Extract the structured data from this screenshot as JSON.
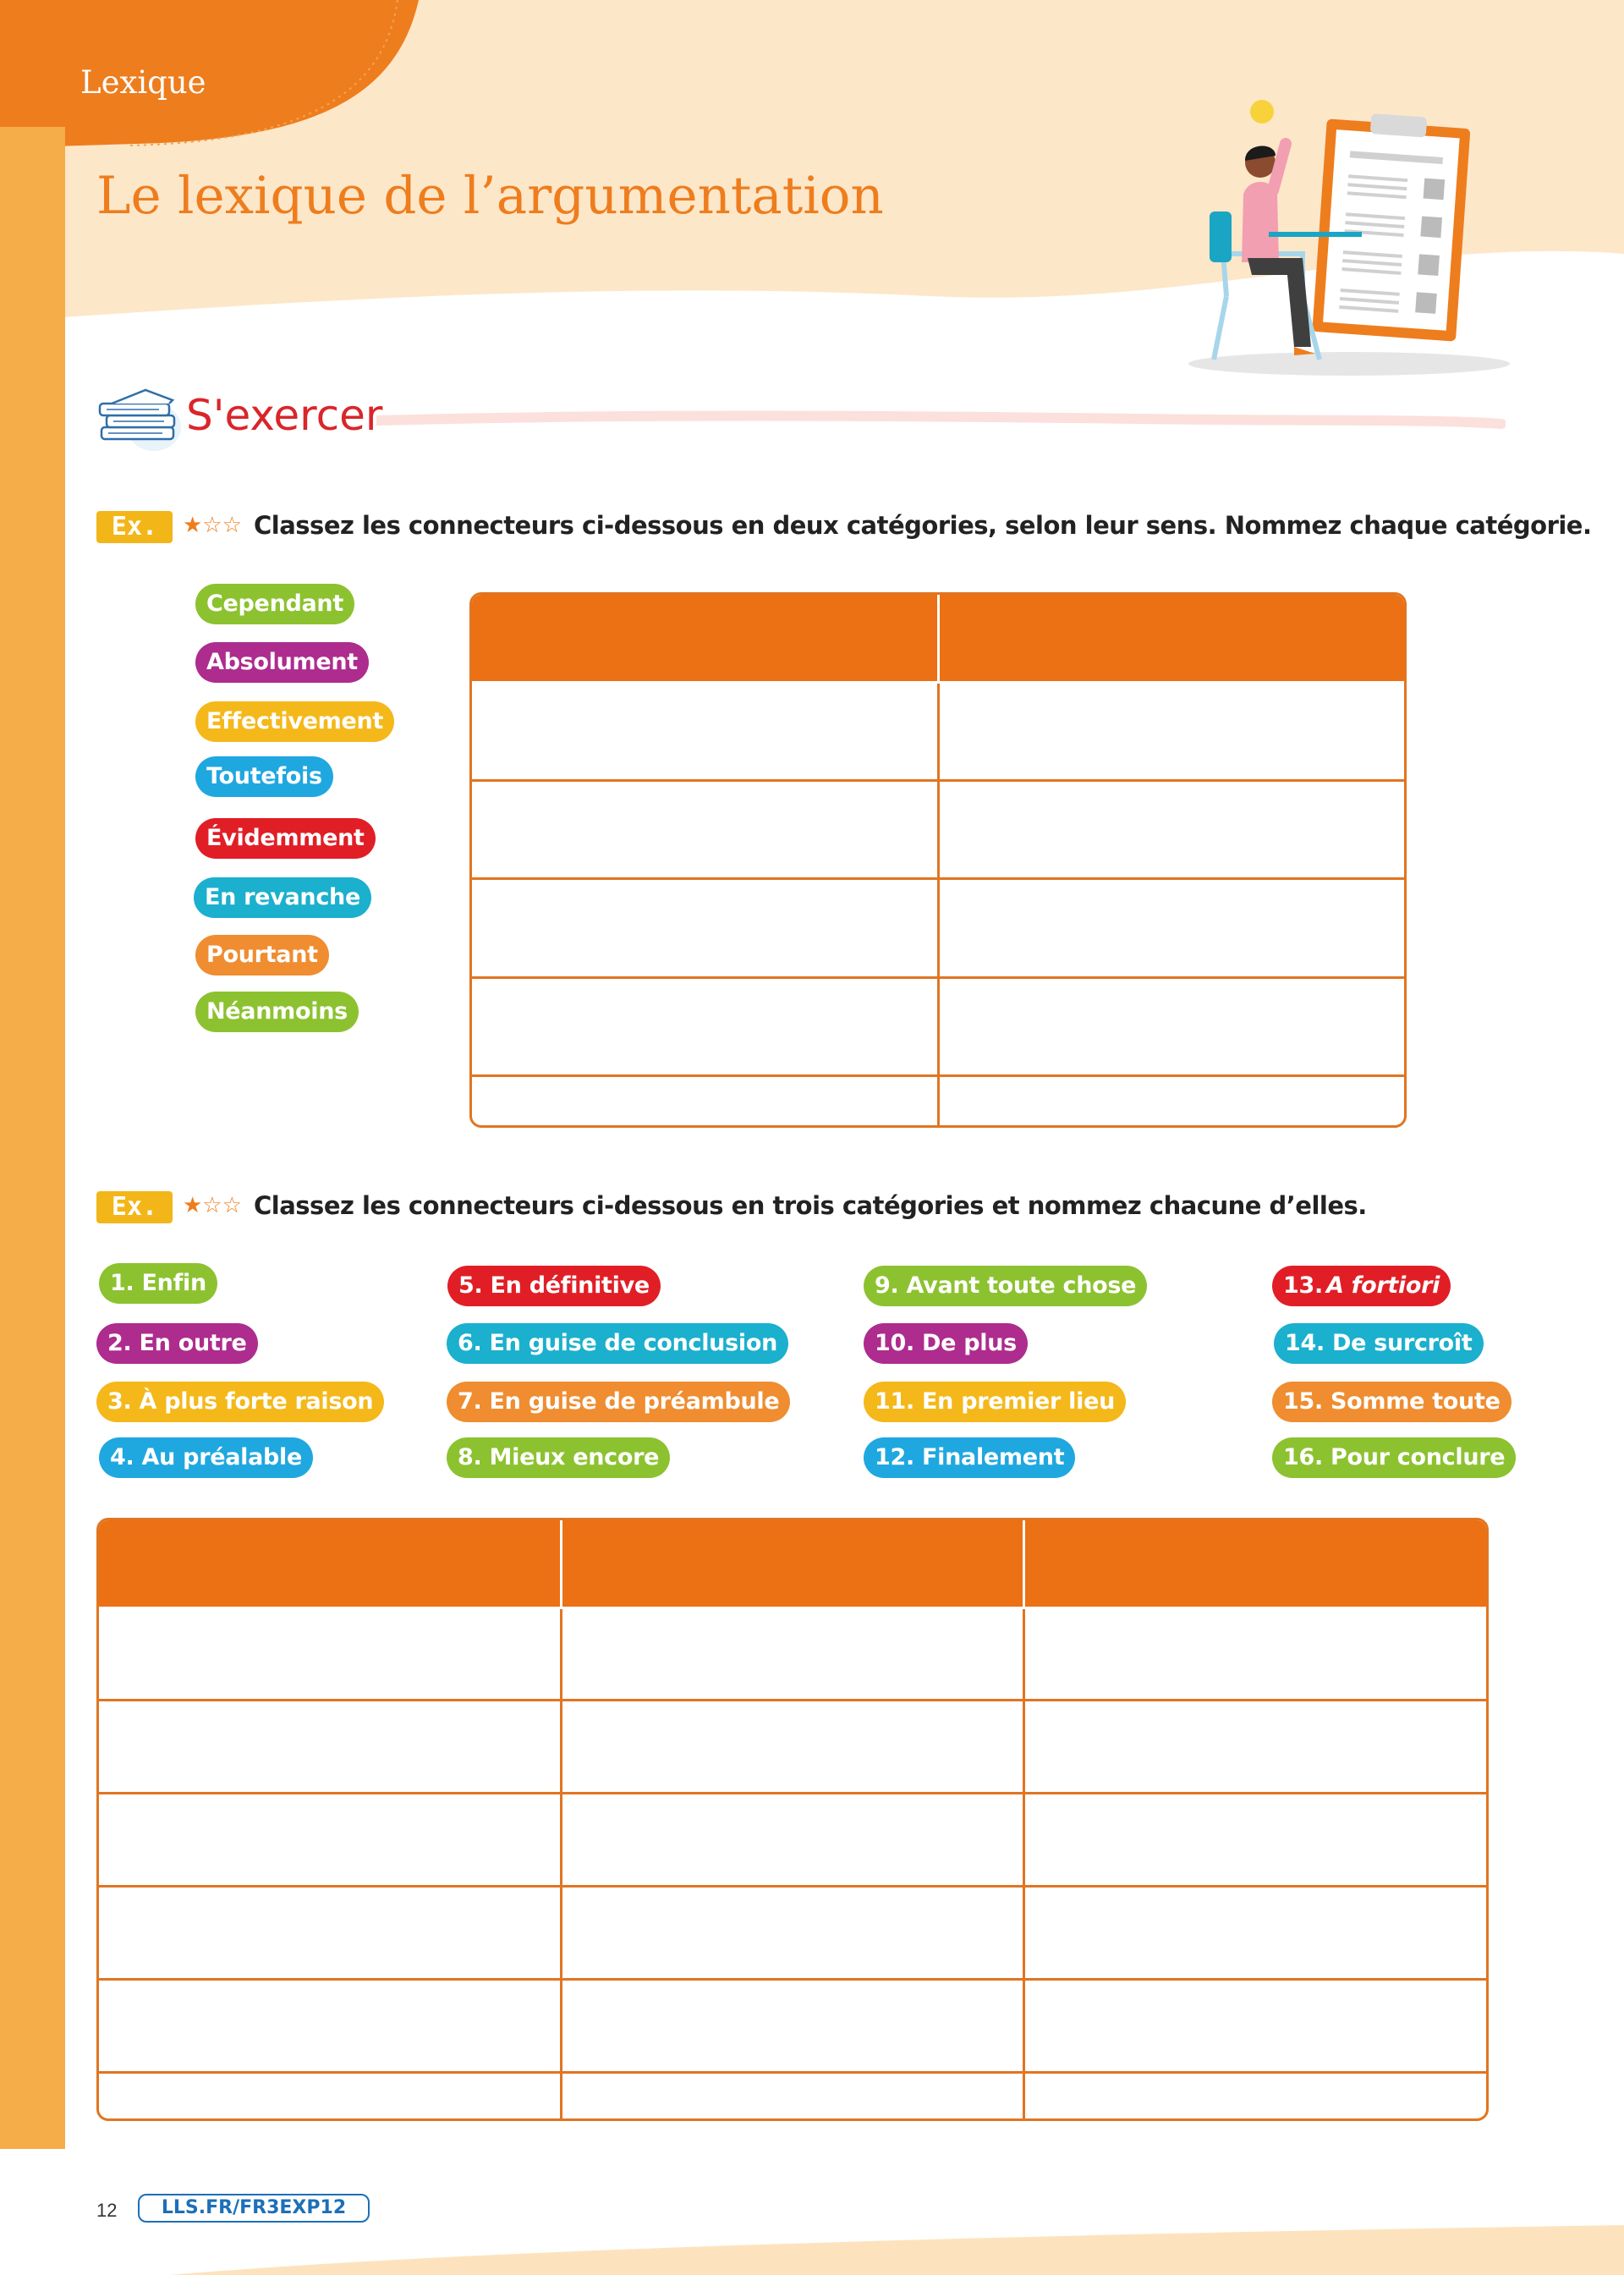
{
  "header": {
    "section_label": "Lexique",
    "title": "Le lexique de l’argumentation"
  },
  "exercise_heading": "S'exercer",
  "ex1": {
    "badge": "Ex. 1",
    "stars": "★☆☆",
    "instruction": "Classez les connecteurs ci-dessous en deux catégories, selon leur sens. Nommez chaque catégorie.",
    "words": [
      {
        "label": "Cependant",
        "color": "#8cc230"
      },
      {
        "label": "Absolument",
        "color": "#ad2c8e"
      },
      {
        "label": "Effectivement",
        "color": "#f4b81a"
      },
      {
        "label": "Toutefois",
        "color": "#1fa7e0"
      },
      {
        "label": "Évidemment",
        "color": "#e11e26"
      },
      {
        "label": "En revanche",
        "color": "#1bb0cd"
      },
      {
        "label": "Pourtant",
        "color": "#ef8d30"
      },
      {
        "label": "Néanmoins",
        "color": "#8cc230"
      }
    ]
  },
  "ex2": {
    "badge": "Ex. 2",
    "stars": "★☆☆",
    "instruction": "Classez les connecteurs ci-dessous en trois catégories et nommez chacune d’elles.",
    "words": [
      {
        "label": "1. Enfin",
        "color": "#8cc230"
      },
      {
        "label": "2. En outre",
        "color": "#ad2c8e"
      },
      {
        "label": "3. À plus forte raison",
        "color": "#f4b81a"
      },
      {
        "label": "4. Au préalable",
        "color": "#1fa7e0"
      },
      {
        "label": "5. En définitive",
        "color": "#e11e26"
      },
      {
        "label": "6. En guise de conclusion",
        "color": "#1bb0cd"
      },
      {
        "label": "7. En guise de préambule",
        "color": "#ef8d30"
      },
      {
        "label": "8. Mieux encore",
        "color": "#8cc230"
      },
      {
        "label": "9. Avant toute chose",
        "color": "#8cc230"
      },
      {
        "label": "10. De plus",
        "color": "#ad2c8e"
      },
      {
        "label": "11. En premier lieu",
        "color": "#f4b81a"
      },
      {
        "label": "12. Finalement",
        "color": "#1fa7e0"
      },
      {
        "label": "13.",
        "italic_part": "A fortiori",
        "color": "#e11e26"
      },
      {
        "label": "14. De surcroît",
        "color": "#1bb0cd"
      },
      {
        "label": "15. Somme toute",
        "color": "#ef8d30"
      },
      {
        "label": "16. Pour conclure",
        "color": "#8cc230"
      }
    ]
  },
  "footer": {
    "page_number": "12",
    "link": "LLS.FR/FR3EXP12"
  },
  "illustration": {
    "icon": "student-checklist-illustration"
  }
}
